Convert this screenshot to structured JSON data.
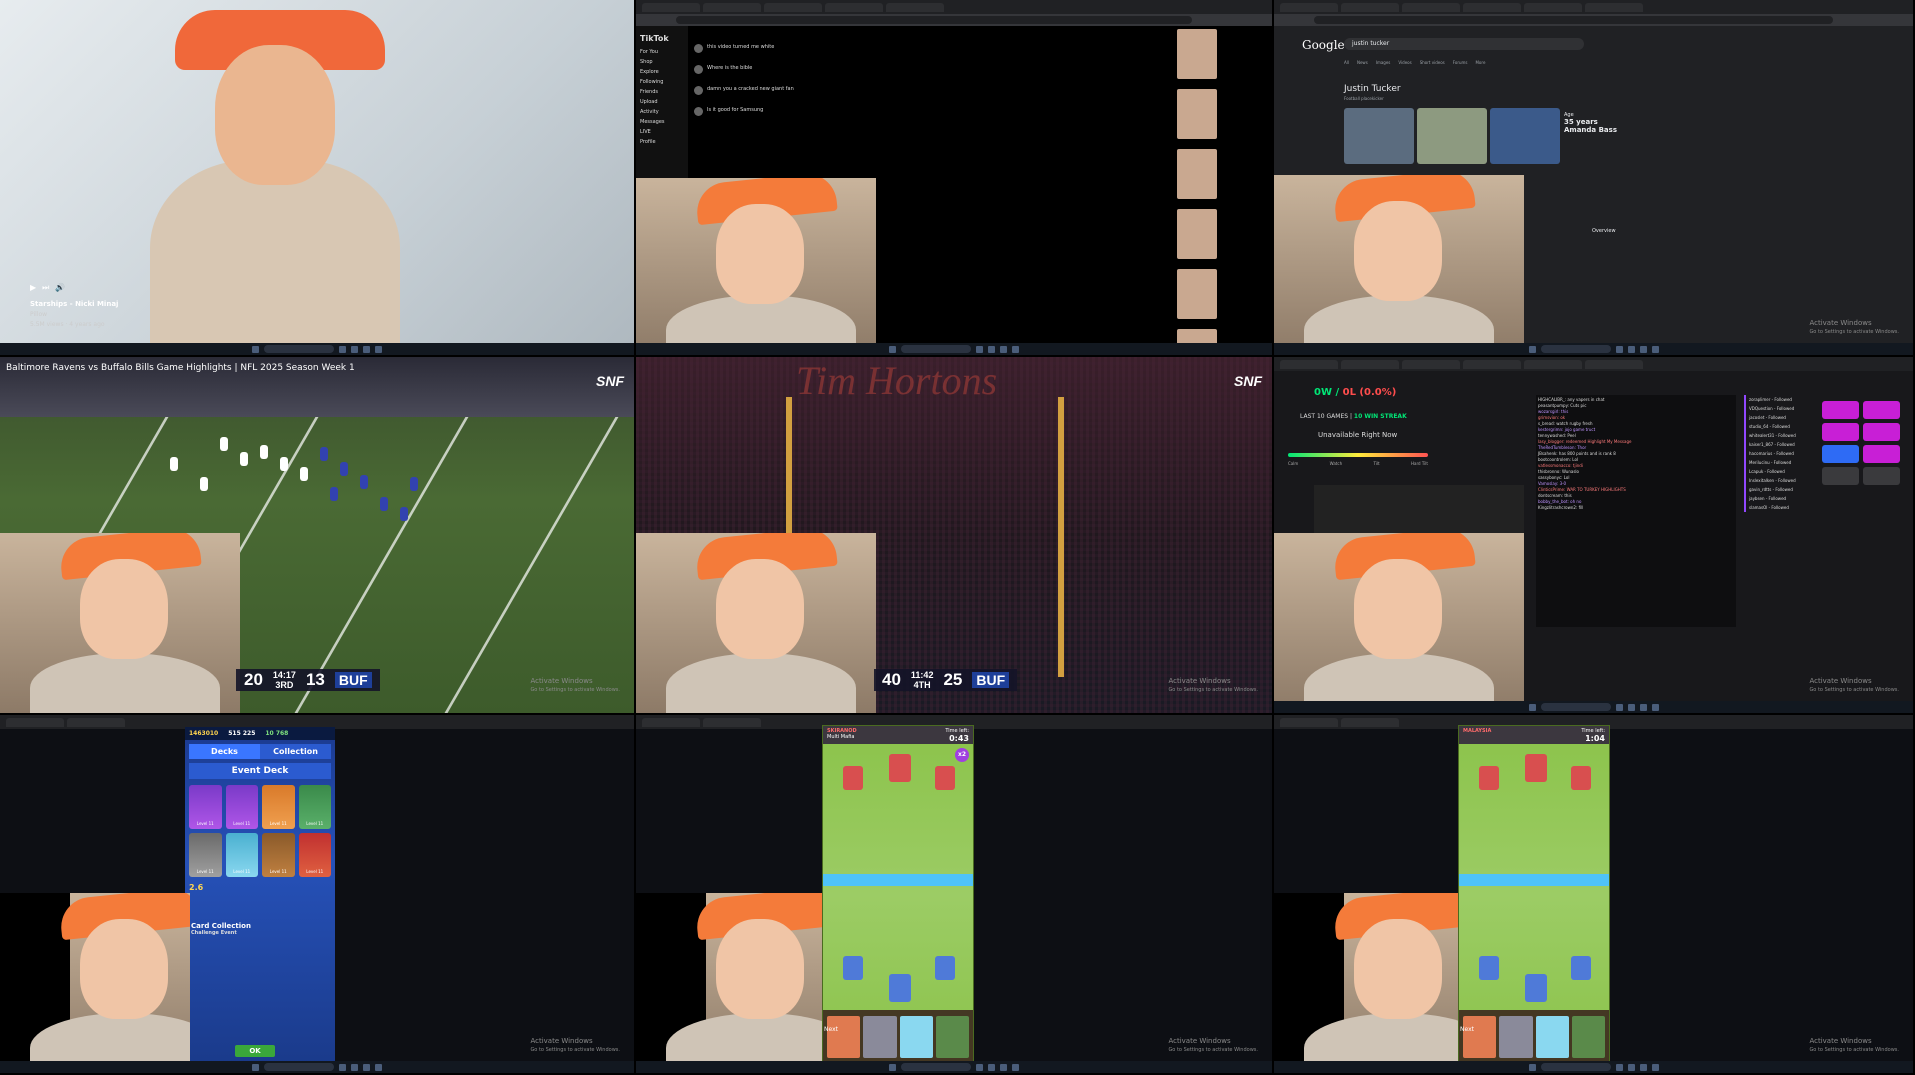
{
  "tiles": {
    "music_video": {
      "song": "Starships - Nicki Minaj",
      "channel": "Pillow",
      "views": "5.5M views · 4 years ago"
    },
    "tiktok": {
      "app": "TikTok",
      "nav": [
        "For You",
        "Shop",
        "Explore",
        "Following",
        "Friends",
        "Upload",
        "Activity",
        "Messages",
        "LIVE",
        "Profile"
      ],
      "comments": [
        "this video turned me white",
        "Where is the bible",
        "damn you a cracked new giant fan",
        "Is it good for Samsung"
      ]
    },
    "google": {
      "logo": "Google",
      "query": "justin tucker",
      "tabs": [
        "All",
        "News",
        "Images",
        "Videos",
        "Short videos",
        "Forums",
        "More"
      ],
      "kp_title": "Justin Tucker",
      "kp_subtitle": "Football placekicker",
      "age_label": "Age",
      "age_value": "35 years",
      "spouse_value": "Amanda Bass",
      "overview": "Overview"
    },
    "football_1": {
      "title": "Baltimore Ravens vs Buffalo Bills Game Highlights | NFL 2025 Season Week 1",
      "network": "SNF",
      "score_left": "20",
      "clock": "14:17",
      "quarter": "3RD",
      "score_right": "13",
      "team_right": "BUF"
    },
    "football_2": {
      "network": "SNF",
      "sponsor": "Tim Hortons",
      "score_left": "40",
      "clock": "11:42",
      "quarter": "4TH",
      "score_right": "25",
      "team_right": "BUF"
    },
    "stream_dashboard": {
      "record_w": "0W",
      "record_l": "0L (0.0%)",
      "last_games": "LAST 10 GAMES",
      "streak": "10 WIN STREAK",
      "unavailable": "Unavailable Right Now",
      "meter_labels": [
        "Calm",
        "Watch",
        "Tilt",
        "Hard Tilt"
      ],
      "chat": [
        "HIGHCALIBR_: any vapers in chat",
        "peasantpumpy: Cuts pic",
        "wozarsgirl: this",
        "grimsvion: ok",
        "s_bread: watch rugby fresh",
        "kestergrimn: jojo game truct",
        "tennywashed: Peel",
        "lasy_blogger: redeemed Highlight My Message",
        "TheRedTumbleson: Thor",
        "JBsahenk: has 800 points and is rank 8",
        "bootcoontrolem: Lol",
        "vatlessmonacco: tjindi",
        "thisbronno: Wunaslo",
        "sassybonyc: Lol",
        "Vamoslay: 3-0",
        "ClinticsPrime: WAR TO TURKEY HIGHLIGHTS",
        "dontscream: this",
        "bobby_the_bot: oh no",
        "Kingzlitrashcrown2: fill"
      ],
      "feed": [
        "zoraplimer - Followed",
        "VDQuestion - Followed",
        "jacoslet - Followed",
        "studio_64 - Followed",
        "whitealert31 - Followed",
        "kaiser1_867 - Followed",
        "hacomarius - Followed",
        "Merilucinu - Followed",
        "Lcapuk - Followed",
        "Inslexitalken - Followed",
        "gavin_rdtts - Followed",
        "jaybsen - Followed",
        "slamasOl - Followed"
      ]
    },
    "clash_deck": {
      "gold": "1463010",
      "gems": "515 225",
      "trophies": "10 768",
      "tab_decks": "Decks",
      "tab_collection": "Collection",
      "event_deck": "Event Deck",
      "card_level": "Level 11",
      "elixir": "2.6",
      "card_collection": "Card Collection",
      "challenge_event": "Challenge Event",
      "ok": "OK"
    },
    "clash_battle_1": {
      "opponent": "SKIRANOD",
      "clan": "Multi Mafia",
      "time_left_label": "Time left:",
      "time_left": "0:43",
      "next": "Next"
    },
    "clash_battle_2": {
      "opponent": "MALAYSIA",
      "time_left_label": "Time left:",
      "time_left": "1:04",
      "next": "Next"
    }
  },
  "watermark": {
    "line1": "Activate Windows",
    "line2": "Go to Settings to activate Windows."
  }
}
